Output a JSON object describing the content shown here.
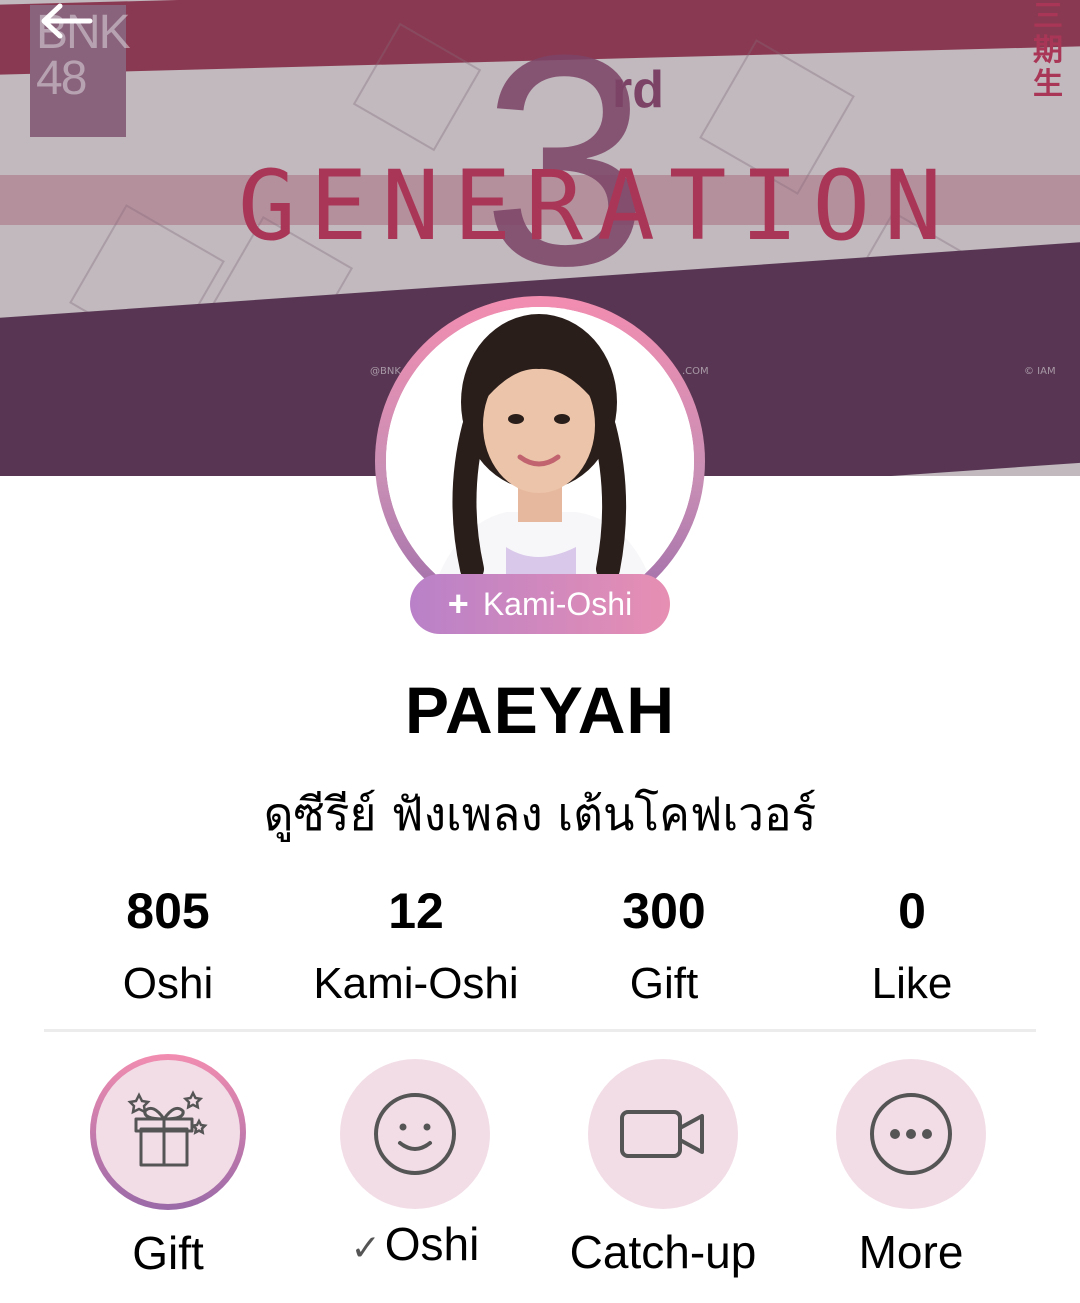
{
  "banner": {
    "logo_text": "BNK\n48",
    "title_word": "GENERATION",
    "generation_number": "3",
    "generation_suffix": "rd",
    "kanji": "三期生",
    "credit_left": "@BNK",
    "credit_mid": ".COM",
    "credit_right": "© IAM"
  },
  "nav": {
    "back_icon": "arrow-left-icon"
  },
  "profile": {
    "avatar_icon": "member-photo",
    "kami_button_icon": "plus-icon",
    "kami_button_label": "Kami-Oshi",
    "name": "PAEYAH",
    "bio": "ดูซีรีย์ ฟังเพลง เต้นโคฟเวอร์"
  },
  "stats": [
    {
      "value": "805",
      "label": "Oshi"
    },
    {
      "value": "12",
      "label": "Kami-Oshi"
    },
    {
      "value": "300",
      "label": "Gift"
    },
    {
      "value": "0",
      "label": "Like"
    }
  ],
  "actions": [
    {
      "label": "Gift",
      "icon": "gift-icon"
    },
    {
      "label": "Oshi",
      "icon": "smile-icon",
      "checked_icon": "check-icon"
    },
    {
      "label": "Catch-up",
      "icon": "video-camera-icon"
    },
    {
      "label": "More",
      "icon": "more-dots-icon"
    }
  ],
  "colors": {
    "accent_pink": "#f28db0",
    "accent_purple": "#9a6aa8",
    "action_bg": "#f2dde6",
    "banner_red": "#c23a5e"
  }
}
